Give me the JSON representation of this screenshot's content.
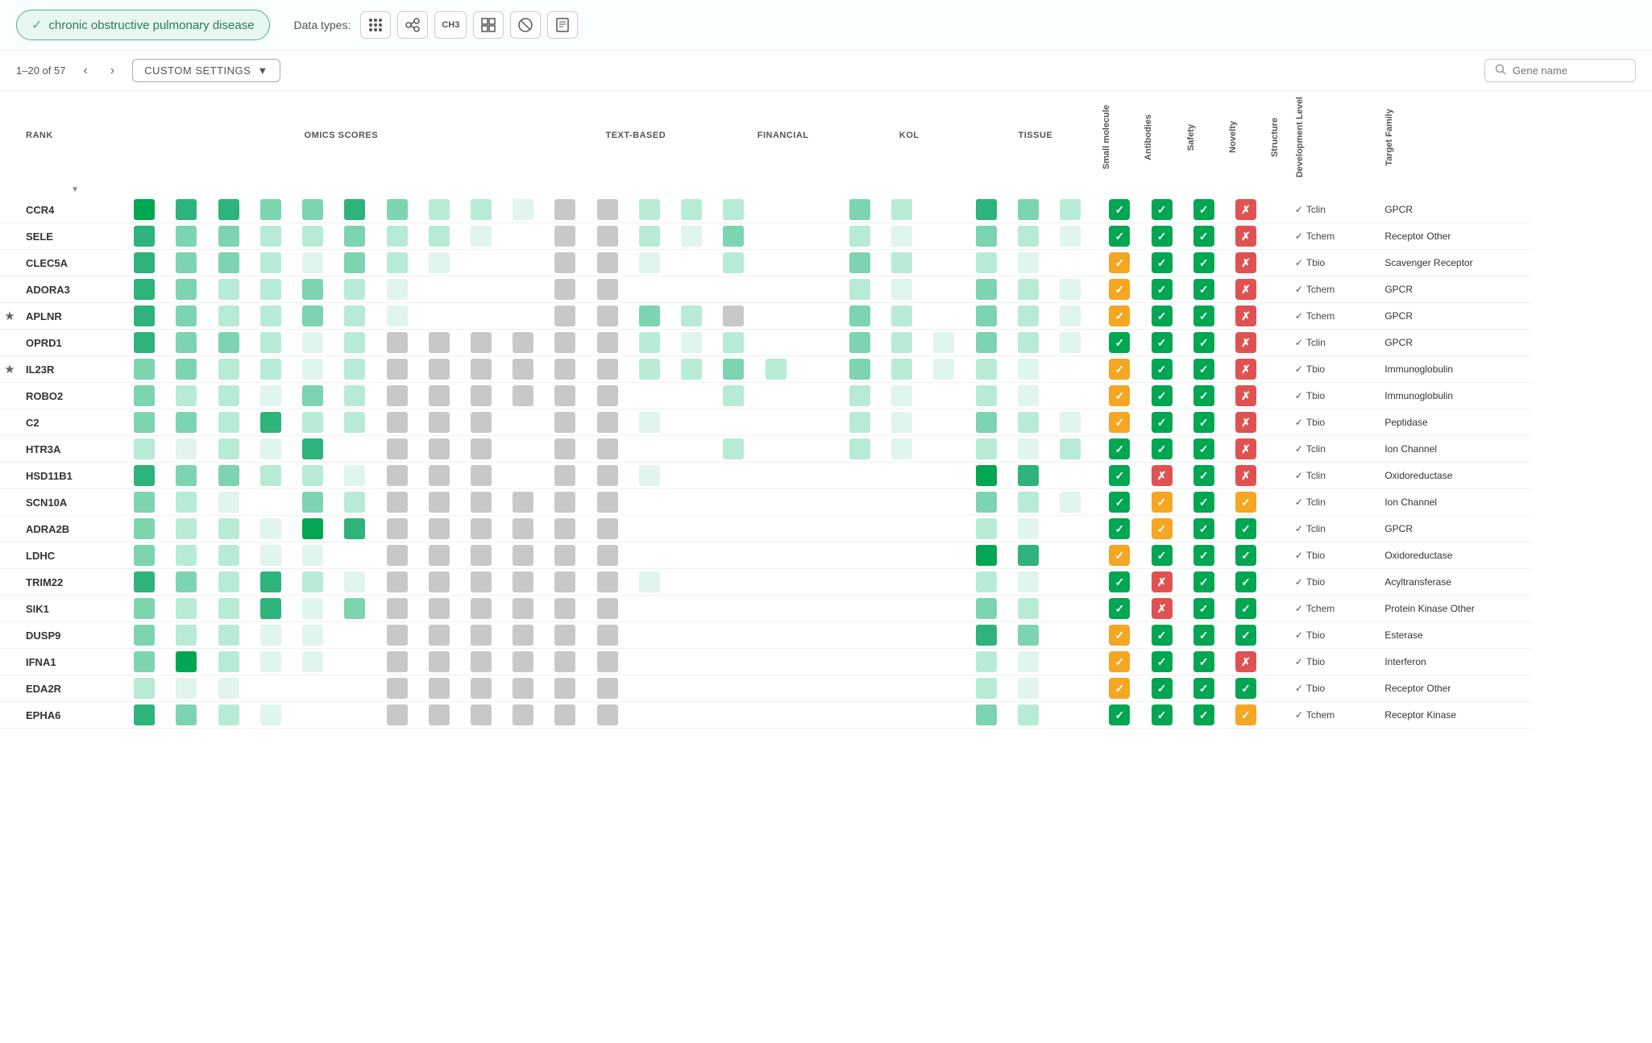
{
  "topbar": {
    "disease": "chronic obstructive pulmonary disease",
    "data_types_label": "Data types:",
    "dt_icons": [
      "⠿",
      "🔗",
      "CH3",
      "▦",
      "⊕",
      "≡"
    ]
  },
  "controls": {
    "pagination": "1–20 of 57",
    "settings_label": "CUSTOM SETTINGS",
    "search_placeholder": "Gene name"
  },
  "columns": {
    "rank_label": "RANK",
    "omics_label": "OMICS SCORES",
    "text_label": "TEXT-BASED",
    "financial_label": "FINANCIAL",
    "kol_label": "KOL",
    "tissue_label": "TISSUE",
    "rotated_headers": [
      "Small molecule",
      "Antibodies",
      "Safety",
      "Novelty",
      "Structure",
      "Development Level",
      "Target Family"
    ]
  },
  "genes": [
    {
      "name": "CCR4",
      "star": false,
      "dev": "Tclin",
      "family": "GPCR"
    },
    {
      "name": "SELE",
      "star": false,
      "dev": "Tchem",
      "family": "Receptor Other"
    },
    {
      "name": "CLEC5A",
      "star": false,
      "dev": "Tbio",
      "family": "Scavenger Receptor"
    },
    {
      "name": "ADORA3",
      "star": false,
      "dev": "Tchem",
      "family": "GPCR"
    },
    {
      "name": "APLNR",
      "star": true,
      "dev": "Tchem",
      "family": "GPCR"
    },
    {
      "name": "OPRD1",
      "star": false,
      "dev": "Tclin",
      "family": "GPCR"
    },
    {
      "name": "IL23R",
      "star": true,
      "dev": "Tbio",
      "family": "Immunoglobulin"
    },
    {
      "name": "ROBO2",
      "star": false,
      "dev": "Tbio",
      "family": "Immunoglobulin"
    },
    {
      "name": "C2",
      "star": false,
      "dev": "Tbio",
      "family": "Peptidase"
    },
    {
      "name": "HTR3A",
      "star": false,
      "dev": "Tclin",
      "family": "Ion Channel"
    },
    {
      "name": "HSD11B1",
      "star": false,
      "dev": "Tclin",
      "family": "Oxidoreductase"
    },
    {
      "name": "SCN10A",
      "star": false,
      "dev": "Tclin",
      "family": "Ion Channel"
    },
    {
      "name": "ADRA2B",
      "star": false,
      "dev": "Tclin",
      "family": "GPCR"
    },
    {
      "name": "LDHC",
      "star": false,
      "dev": "Tbio",
      "family": "Oxidoreductase"
    },
    {
      "name": "TRIM22",
      "star": false,
      "dev": "Tbio",
      "family": "Acyltransferase"
    },
    {
      "name": "SIK1",
      "star": false,
      "dev": "Tchem",
      "family": "Protein Kinase Other"
    },
    {
      "name": "DUSP9",
      "star": false,
      "dev": "Tbio",
      "family": "Esterase"
    },
    {
      "name": "IFNA1",
      "star": false,
      "dev": "Tbio",
      "family": "Interferon"
    },
    {
      "name": "EDA2R",
      "star": false,
      "dev": "Tbio",
      "family": "Receptor Other"
    },
    {
      "name": "EPHA6",
      "star": false,
      "dev": "Tchem",
      "family": "Receptor Kinase"
    }
  ]
}
